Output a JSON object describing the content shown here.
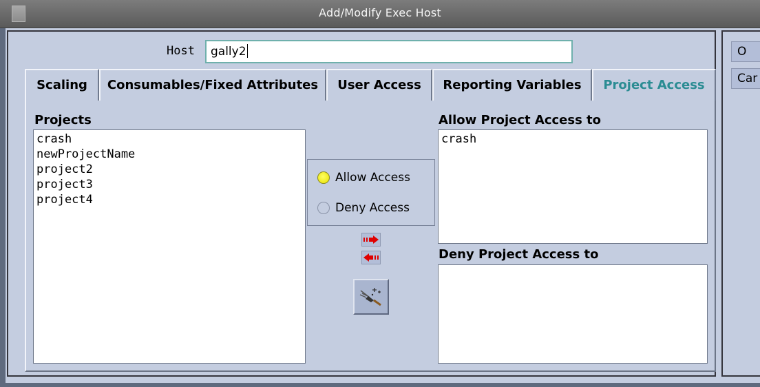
{
  "window": {
    "title": "Add/Modify Exec Host"
  },
  "host": {
    "label": "Host",
    "value": "gally2"
  },
  "side_buttons": [
    {
      "label": "O"
    },
    {
      "label": "Car"
    }
  ],
  "tabs": [
    {
      "label": "Scaling"
    },
    {
      "label": "Consumables/Fixed Attributes"
    },
    {
      "label": "User Access"
    },
    {
      "label": "Reporting Variables"
    },
    {
      "label": "Project Access",
      "active": true
    }
  ],
  "projects": {
    "label": "Projects",
    "items": [
      "crash",
      "newProjectName",
      "project2",
      "project3",
      "project4"
    ]
  },
  "access_mode": {
    "options": [
      {
        "label": "Allow Access",
        "selected": true
      },
      {
        "label": "Deny Access",
        "selected": false
      }
    ]
  },
  "allow_list": {
    "label": "Allow Project Access to",
    "items": [
      "crash"
    ]
  },
  "deny_list": {
    "label": "Deny Project Access to",
    "items": []
  },
  "icons": {
    "add": "arrow-right-icon",
    "remove": "arrow-left-icon",
    "tool": "clear-list-icon"
  },
  "colors": {
    "active_tab": "#2b8c93",
    "radio_selected": "#f0f000",
    "arrow": "#e00000"
  }
}
